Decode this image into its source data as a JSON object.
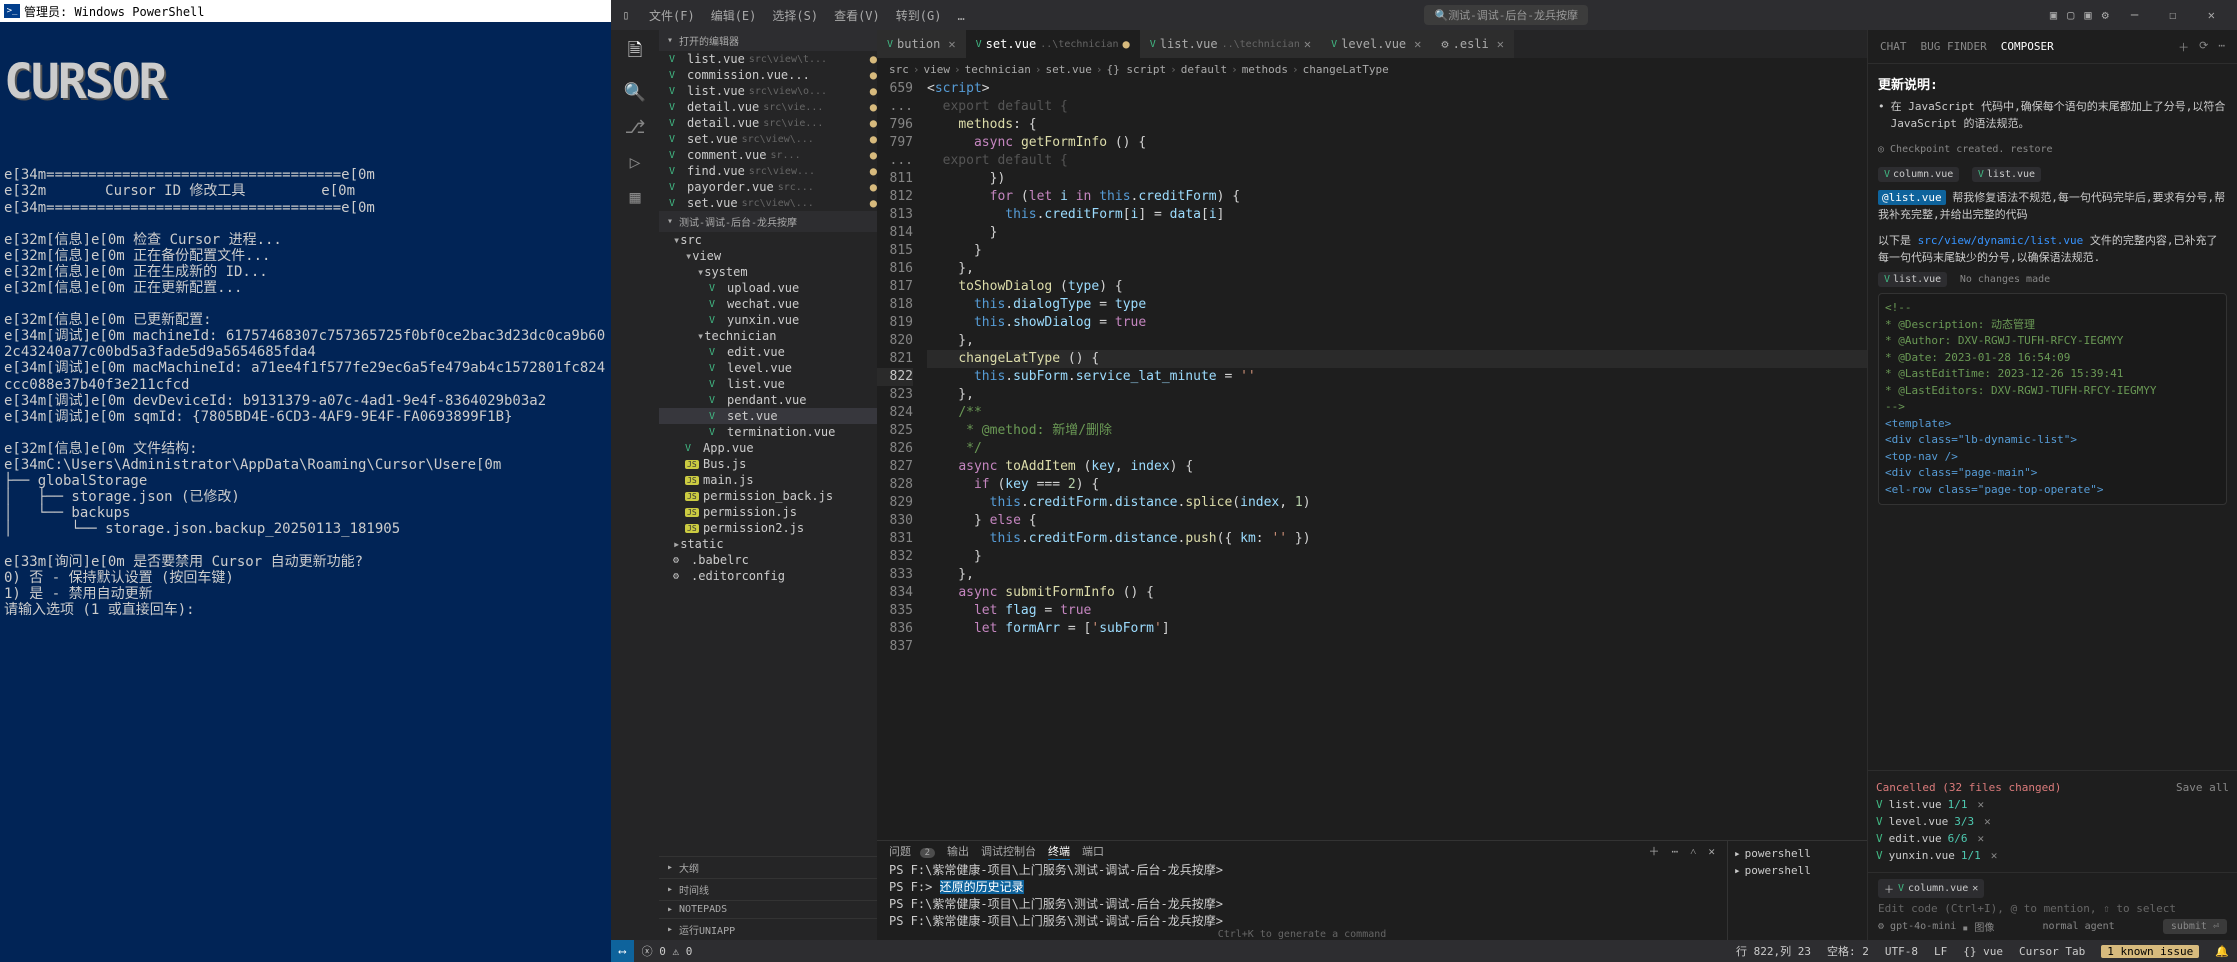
{
  "powershell": {
    "title": "管理员: Windows PowerShell",
    "ascii": "CURSOR",
    "lines": [
      "e[34m===================================e[0m",
      "e[32m       Cursor ID 修改工具         e[0m",
      "e[34m===================================e[0m",
      "",
      "e[32m[信息]e[0m 检查 Cursor 进程...",
      "e[32m[信息]e[0m 正在备份配置文件...",
      "e[32m[信息]e[0m 正在生成新的 ID...",
      "e[32m[信息]e[0m 正在更新配置...",
      "",
      "e[32m[信息]e[0m 已更新配置:",
      "e[34m[调试]e[0m machineId: 61757468307c757365725f0bf0ce2bac3d23dc0ca9b602c43240a77c00bd5a3fade5d9a5654685fda4",
      "e[34m[调试]e[0m macMachineId: a71ee4f1f577fe29ec6a5fe479ab4c1572801fc824ccc088e37b40f3e211cfcd",
      "e[34m[调试]e[0m devDeviceId: b9131379-a07c-4ad1-9e4f-8364029b03a2",
      "e[34m[调试]e[0m sqmId: {7805BD4E-6CD3-4AF9-9E4F-FA0693899F1B}",
      "",
      "e[32m[信息]e[0m 文件结构:",
      "e[34mC:\\Users\\Administrator\\AppData\\Roaming\\Cursor\\Usere[0m",
      "├── globalStorage",
      "│   ├── storage.json (已修改)",
      "│   └── backups",
      "│       └── storage.json.backup_20250113_181905",
      "",
      "e[33m[询问]e[0m 是否要禁用 Cursor 自动更新功能?",
      "0) 否 - 保持默认设置 (按回车键)",
      "1) 是 - 禁用自动更新",
      "请输入选项 (1 或直接回车):"
    ]
  },
  "titlebar": {
    "menus": [
      "文件(F)",
      "编辑(E)",
      "选择(S)",
      "查看(V)",
      "转到(G)",
      "…"
    ],
    "search": "测试-调试-后台-龙兵按摩"
  },
  "sidebar": {
    "openEditors": "打开的编辑器",
    "openList": [
      {
        "name": "list.vue",
        "path": "src\\view\\t..."
      },
      {
        "name": "commission.vue...",
        "path": ""
      },
      {
        "name": "list.vue",
        "path": "src\\view\\o..."
      },
      {
        "name": "detail.vue",
        "path": "src\\vie..."
      },
      {
        "name": "detail.vue",
        "path": "src\\vie..."
      },
      {
        "name": "set.vue",
        "path": "src\\view\\..."
      },
      {
        "name": "comment.vue",
        "path": "sr..."
      },
      {
        "name": "find.vue",
        "path": "src\\view..."
      },
      {
        "name": "payorder.vue",
        "path": "src..."
      },
      {
        "name": "set.vue",
        "path": "src\\view\\..."
      }
    ],
    "projectName": "测试-调试-后台-龙兵按摩",
    "tree": {
      "src": "src",
      "view": "view",
      "system": "system",
      "systemFiles": [
        "upload.vue",
        "wechat.vue",
        "yunxin.vue"
      ],
      "technician": "technician",
      "techFiles": [
        "edit.vue",
        "level.vue",
        "list.vue",
        "pendant.vue",
        "set.vue",
        "termination.vue"
      ],
      "rootFiles": [
        "App.vue",
        "Bus.js",
        "main.js",
        "permission_back.js",
        "permission.js",
        "permission2.js"
      ],
      "static": "static",
      "configs": [
        ".babelrc",
        ".editorconfig"
      ]
    },
    "bottomSections": [
      "大纲",
      "时间线",
      "NOTEPADS",
      "运行UNIAPP"
    ]
  },
  "tabs": [
    {
      "label": "bution",
      "path": "",
      "active": false
    },
    {
      "label": "set.vue",
      "path": "..\\technician",
      "active": true,
      "modified": true
    },
    {
      "label": "list.vue",
      "path": "..\\technician",
      "active": false
    },
    {
      "label": "level.vue",
      "path": "",
      "active": false
    },
    {
      "label": ".esli",
      "path": "",
      "active": false
    }
  ],
  "crumbs": [
    "src",
    "view",
    "technician",
    "set.vue",
    "{} script",
    "default",
    "methods",
    "changeLatType"
  ],
  "lineNumbers": [
    "659",
    "...",
    "796",
    "797",
    "...",
    "811",
    "812",
    "813",
    "814",
    "815",
    "816",
    "817",
    "818",
    "819",
    "820",
    "821",
    "822",
    "823",
    "824",
    "825",
    "826",
    "827",
    "828",
    "829",
    "830",
    "831",
    "832",
    "833",
    "834",
    "835",
    "836",
    "837"
  ],
  "code": {
    "l659": "<script>",
    "l796": "    methods: {",
    "l797": "      async getFormInfo () {",
    "l811": "        })",
    "l812": "",
    "l813": "        for (let i in this.creditForm) {",
    "l814": "          this.creditForm[i] = data[i]",
    "l815": "        }",
    "l816": "      }",
    "l817": "    },",
    "l818": "    toShowDialog (type) {",
    "l819": "      this.dialogType = type",
    "l820": "      this.showDialog = true",
    "l821": "    },",
    "l822": "    changeLatType () {",
    "l823": "      this.subForm.service_lat_minute = ''",
    "l824": "    },",
    "l825": "    /**",
    "l826": "     * @method: 新增/删除",
    "l827": "     */",
    "l828": "    async toAddItem (key, index) {",
    "l829": "      if (key === 2) {",
    "l830": "        this.creditForm.distance.splice(index, 1)",
    "l831": "      } else {",
    "l832": "        this.creditForm.distance.push({ km: '' })",
    "l833": "      }",
    "l834": "    },",
    "l835": "    async submitFormInfo () {",
    "l836": "      let flag = true",
    "l837": "      let formArr = ['subForm']"
  },
  "terminal": {
    "tabs": [
      "问题",
      "输出",
      "调试控制台",
      "终端",
      "端口"
    ],
    "badge": "2",
    "lines": [
      "PS F:\\紫常健康-项目\\上门服务\\测试-调试-后台-龙兵按摩>",
      "PS F:> 还原的历史记录",
      "PS F:\\紫常健康-项目\\上门服务\\测试-调试-后台-龙兵按摩>",
      "PS F:\\紫常健康-项目\\上门服务\\测试-调试-后台-龙兵按摩>"
    ],
    "hint": "Ctrl+K to generate a command",
    "side": [
      "powershell",
      "powershell"
    ]
  },
  "composer": {
    "tabs": [
      "CHAT",
      "BUG FINDER",
      "COMPOSER"
    ],
    "updateTitle": "更新说明:",
    "updateText": "在 JavaScript 代码中,确保每个语句的末尾都加上了分号,以符合 JavaScript 的语法规范。",
    "checkpoint": "Checkpoint created.",
    "restore": "restore",
    "chips": [
      "column.vue",
      "list.vue"
    ],
    "linkText": "@list.vue",
    "requestText": "帮我修复语法不规范,每一句代码完毕后,要求有分号,帮我补充完整,并给出完整的代码",
    "pathPrefix": "以下是",
    "pathLink": "src/view/dynamic/list.vue",
    "pathSuffix": "文件的完整内容,已补充了每一句代码末尾缺少的分号,以确保语法规范.",
    "listChip": "list.vue",
    "noChanges": "No changes made",
    "codeLines": [
      "<!--",
      " * @Description: 动态管理",
      " * @Author: DXV-RGWJ-TUFH-RFCY-IEGMYY",
      " * @Date: 2023-01-28 16:54:09",
      " * @LastEditTime: 2023-12-26 15:39:41",
      " * @LastEditors: DXV-RGWJ-TUFH-RFCY-IEGMYY",
      "-->",
      "",
      "<template>",
      "  <div class=\"lb-dynamic-list\">",
      "    <top-nav />",
      "    <div class=\"page-main\">",
      "      <el-row class=\"page-top-operate\">"
    ],
    "cancelled": "Cancelled (32 files changed)",
    "saveAll": "Save all",
    "changedFiles": [
      {
        "name": "list.vue",
        "diff": "1/1"
      },
      {
        "name": "level.vue",
        "diff": "3/3"
      },
      {
        "name": "edit.vue",
        "diff": "6/6"
      },
      {
        "name": "yunxin.vue",
        "diff": "1/1"
      }
    ],
    "inputChip": "column.vue",
    "placeholder": "Edit code (Ctrl+I), @ to mention, ⇧ to select",
    "model": "gpt-4o-mini",
    "modeImg": "图像",
    "normal": "normal",
    "agent": "agent",
    "submit": "submit"
  },
  "statusbar": {
    "errors": "0",
    "warnings": "0",
    "line": "行 822,列 23",
    "spaces": "空格: 2",
    "encoding": "UTF-8",
    "eol": "LF",
    "lang": "vue",
    "cursorTab": "Cursor Tab",
    "issue": "1 known issue"
  }
}
